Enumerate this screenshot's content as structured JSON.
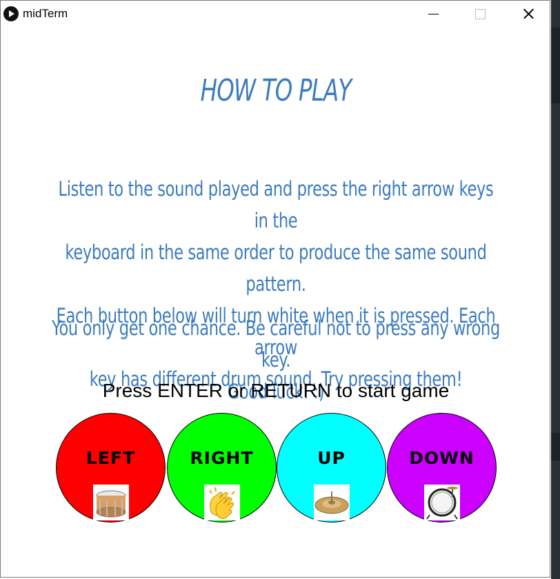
{
  "window": {
    "title": "midTerm",
    "controls": [
      "minimize",
      "maximize",
      "close"
    ]
  },
  "screen": {
    "heading": "HOW TO PLAY",
    "instructions": {
      "paragraph1_lines": [
        "Listen to the sound played and press the right arrow keys in the",
        "keyboard in the same order to produce the same sound pattern.",
        "Each button below will turn white when it is pressed. Each arrow",
        "key has different drum sound. Try pressing them!"
      ],
      "paragraph2_lines": [
        "You only get one chance. Be careful not to press any wrong key.",
        "Good luck! :)"
      ]
    },
    "start_prompt": "Press ENTER or RETURN to start game",
    "pads": [
      {
        "label": "LEFT",
        "color": "#ff0000",
        "icon": "snare-drum-icon"
      },
      {
        "label": "RIGHT",
        "color": "#00ff00",
        "icon": "clapping-hands-icon"
      },
      {
        "label": "UP",
        "color": "#00ffff",
        "icon": "cymbal-icon"
      },
      {
        "label": "DOWN",
        "color": "#cc00ff",
        "icon": "bass-drum-icon"
      }
    ]
  },
  "colors": {
    "text_accent": "#3c7bbd",
    "background": "#ffffff"
  }
}
